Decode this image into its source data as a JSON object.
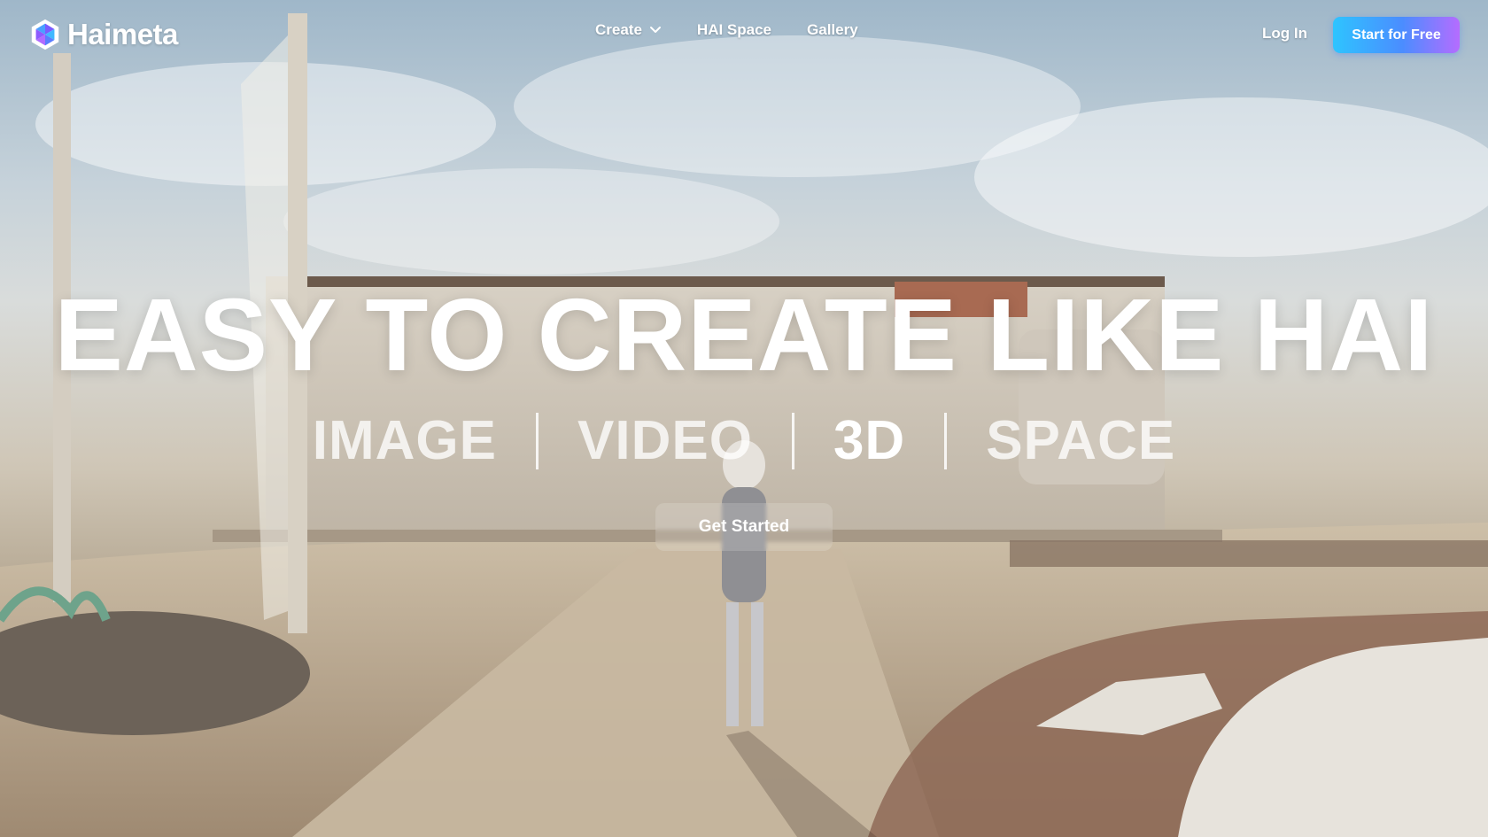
{
  "brand": {
    "name": "Haimeta",
    "logo_icon": "haimeta-hexagon-logo"
  },
  "nav": {
    "items": [
      {
        "label": "Create",
        "has_dropdown": true
      },
      {
        "label": "HAI Space",
        "has_dropdown": false
      },
      {
        "label": "Gallery",
        "has_dropdown": false
      }
    ],
    "login_label": "Log In",
    "cta_label": "Start for Free"
  },
  "hero": {
    "headline": "EASY TO CREATE LIKE HAI",
    "modes": [
      "IMAGE",
      "VIDEO",
      "3D",
      "SPACE"
    ],
    "active_mode": "3D",
    "button_label": "Get Started"
  },
  "colors": {
    "cta_gradient_start": "#2ec4ff",
    "cta_gradient_end": "#b56cff",
    "text": "#ffffff"
  }
}
